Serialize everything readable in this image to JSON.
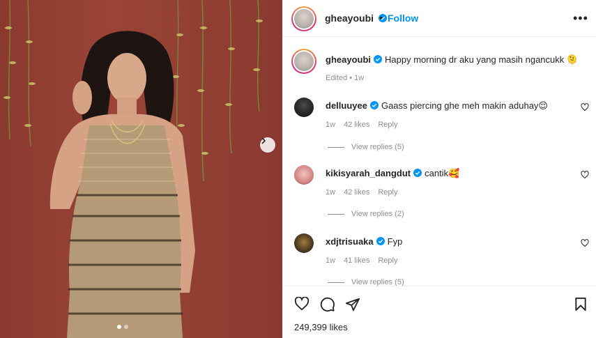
{
  "post": {
    "username": "gheayoubi",
    "follow_label": "Follow",
    "separator": "•",
    "more_label": "•••",
    "caption": "Happy morning dr aku yang masih ngancukk 🫠",
    "caption_meta": "Edited • 1w",
    "likes": "249,399 likes",
    "carousel_dots": 2
  },
  "comments": [
    {
      "username": "delluuyee",
      "verified": true,
      "text": "Gaass piercing ghe meh makin aduhay😌",
      "age": "1w",
      "likes": "42 likes",
      "reply": "Reply",
      "view_replies": "View replies (5)"
    },
    {
      "username": "kikisyarah_dangdut",
      "verified": true,
      "text": "cantik🥰",
      "age": "1w",
      "likes": "42 likes",
      "reply": "Reply",
      "view_replies": "View replies (2)"
    },
    {
      "username": "xdjtrisuaka",
      "verified": true,
      "text": "Fyp",
      "age": "1w",
      "likes": "41 likes",
      "reply": "Reply",
      "view_replies": "View replies (5)"
    }
  ],
  "icons": {
    "like": "heart-icon",
    "comment": "comment-icon",
    "share": "share-icon",
    "save": "bookmark-icon",
    "verified": "verified-badge-icon",
    "next": "chevron-right-icon"
  },
  "colors": {
    "accent": "#0095f6",
    "text": "#262626",
    "muted": "#8e8e8e",
    "wall": "#8b3a30"
  }
}
